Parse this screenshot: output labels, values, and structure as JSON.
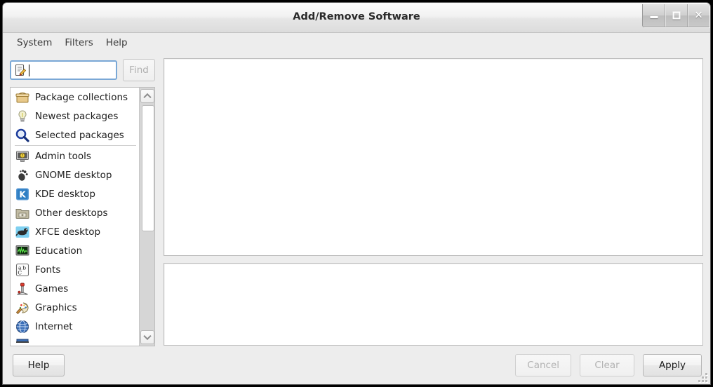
{
  "window": {
    "title": "Add/Remove Software",
    "controls": [
      {
        "name": "minimize-button",
        "glyph": "minimize"
      },
      {
        "name": "maximize-button",
        "glyph": "maximize"
      },
      {
        "name": "close-button",
        "glyph": "✕"
      }
    ]
  },
  "menubar": {
    "items": [
      {
        "label": "System"
      },
      {
        "label": "Filters"
      },
      {
        "label": "Help"
      }
    ]
  },
  "search": {
    "value": "",
    "placeholder": "",
    "icon": "edit-find-icon",
    "find_label": "Find",
    "find_enabled": false
  },
  "categories": {
    "items": [
      {
        "label": "Package collections",
        "icon": "package-box-icon"
      },
      {
        "label": "Newest packages",
        "icon": "lightbulb-icon"
      },
      {
        "label": "Selected packages",
        "icon": "magnifier-icon"
      },
      {
        "separator_after": true,
        "label": "",
        "icon": ""
      },
      {
        "label": "Admin tools",
        "icon": "admin-monitor-icon"
      },
      {
        "label": "GNOME desktop",
        "icon": "gnome-foot-icon"
      },
      {
        "label": "KDE desktop",
        "icon": "kde-gear-icon"
      },
      {
        "label": "Other desktops",
        "icon": "folder-icon"
      },
      {
        "label": "XFCE desktop",
        "icon": "xfce-mouse-icon"
      },
      {
        "label": "Education",
        "icon": "education-monitor-icon"
      },
      {
        "label": "Fonts",
        "icon": "fonts-abc-icon"
      },
      {
        "label": "Games",
        "icon": "joystick-icon"
      },
      {
        "label": "Graphics",
        "icon": "palette-icon"
      },
      {
        "label": "Internet",
        "icon": "globe-icon"
      }
    ],
    "scrollbar": {
      "up_icon": "chevron-up-icon",
      "down_icon": "chevron-down-icon",
      "thumb_fraction": 0.56
    }
  },
  "panes": {
    "package_list": {
      "content": ""
    },
    "description": {
      "content": ""
    }
  },
  "footer": {
    "help_label": "Help",
    "cancel_label": "Cancel",
    "clear_label": "Clear",
    "apply_label": "Apply",
    "cancel_enabled": false,
    "clear_enabled": false,
    "apply_enabled": true
  },
  "colors": {
    "window_bg": "#ededed",
    "pane_bg": "#ffffff",
    "focus_border": "#7aa8d6",
    "text": "#1c1c1c",
    "disabled_text": "#b2b2b2"
  }
}
